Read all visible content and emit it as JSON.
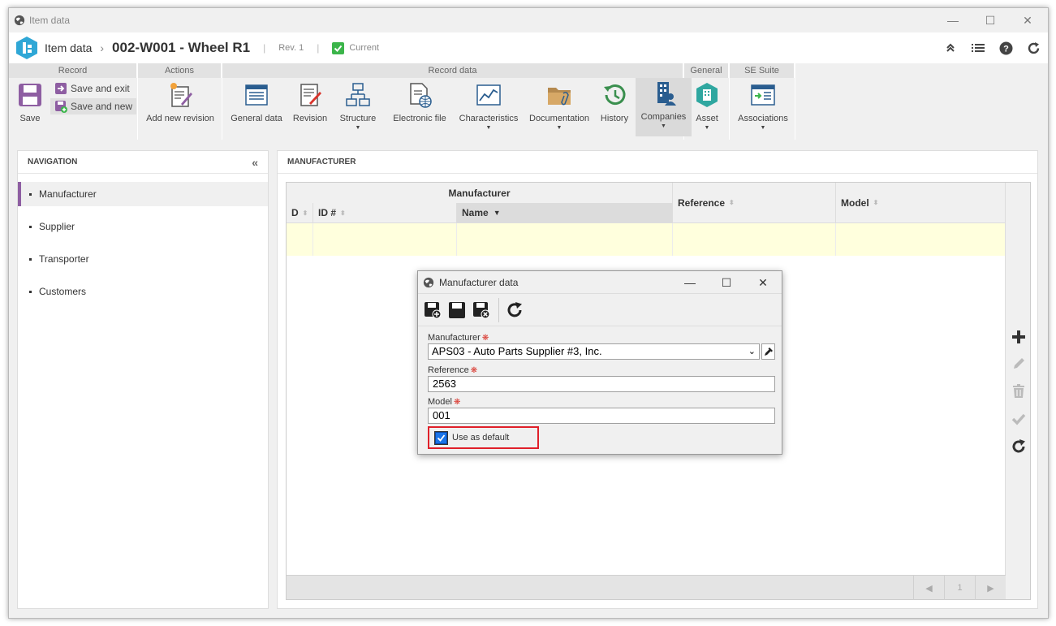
{
  "window": {
    "title": "Item data"
  },
  "header": {
    "module": "Item data",
    "record_title": "002-W001 - Wheel R1",
    "separator": "|",
    "revision": "Rev. 1",
    "status": "Current"
  },
  "ribbon": {
    "groups": {
      "record": "Record",
      "actions": "Actions",
      "record_data": "Record data",
      "general": "General",
      "se_suite": "SE Suite"
    },
    "buttons": {
      "save": "Save",
      "save_exit": "Save and exit",
      "save_new": "Save and new",
      "add_revision": "Add new revision",
      "general_data": "General data",
      "revision": "Revision",
      "structure": "Structure",
      "electronic_file": "Electronic file",
      "characteristics": "Characteristics",
      "documentation": "Documentation",
      "history": "History",
      "companies": "Companies",
      "asset": "Asset",
      "associations": "Associations"
    }
  },
  "navigation": {
    "title": "NAVIGATION",
    "items": [
      {
        "label": "Manufacturer"
      },
      {
        "label": "Supplier"
      },
      {
        "label": "Transporter"
      },
      {
        "label": "Customers"
      }
    ]
  },
  "main": {
    "title": "MANUFACTURER",
    "grid": {
      "group_header": "Manufacturer",
      "columns": {
        "d": "D",
        "id": "ID #",
        "name": "Name",
        "reference": "Reference",
        "model": "Model"
      }
    },
    "pager": {
      "page": "1"
    }
  },
  "dialog": {
    "title": "Manufacturer data",
    "manufacturer_label": "Manufacturer",
    "manufacturer_value": "APS03 - Auto Parts Supplier #3, Inc.",
    "reference_label": "Reference",
    "reference_value": "2563",
    "model_label": "Model",
    "model_value": "001",
    "default_label": "Use as default",
    "default_checked": true
  },
  "colors": {
    "accent_purple": "#8e5ea2",
    "status_green": "#3bb54a",
    "highlight_red": "#e0202a",
    "row_yellow": "#ffffdd"
  }
}
